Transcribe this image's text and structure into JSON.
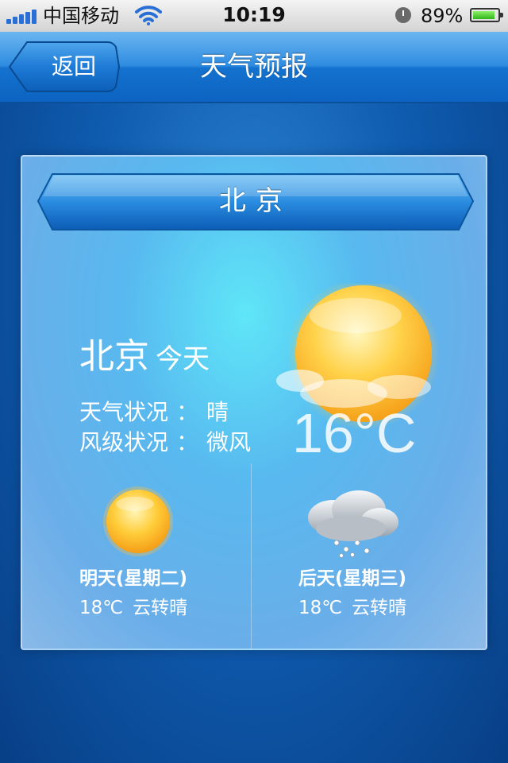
{
  "status_bar": {
    "carrier": "中国移动",
    "time": "10:19",
    "battery_percent": "89%",
    "battery_level": 0.89,
    "signal_bars": 5
  },
  "nav": {
    "back_label": "返回",
    "title": "天气预报"
  },
  "city_banner": "北京",
  "today": {
    "city": "北京",
    "label": "今天",
    "weather_label": "天气状况",
    "weather_value": "晴",
    "wind_label": "风级状况",
    "wind_value": "微风",
    "separator": "：",
    "temperature": "16°C",
    "icon": "sun-partly-cloudy-icon"
  },
  "forecast": [
    {
      "day": "明天(星期二)",
      "temp": "18℃",
      "condition": "云转晴",
      "icon": "sun-icon"
    },
    {
      "day": "后天(星期三)",
      "temp": "18℃",
      "condition": "云转晴",
      "icon": "snow-cloud-icon"
    }
  ],
  "colors": {
    "nav_blue": "#1472cf",
    "background": "#0f5cb0",
    "sun": "#ffc42a",
    "signal_blue": "#2a6fd6",
    "battery_green": "#2fb51a"
  }
}
